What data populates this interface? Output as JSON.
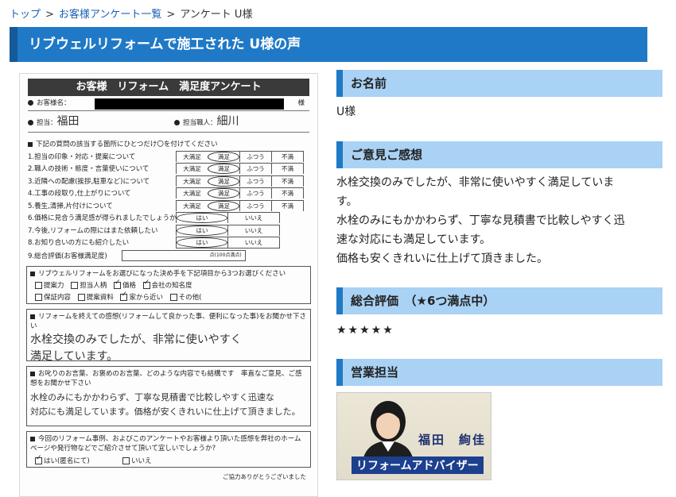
{
  "breadcrumb": {
    "home": "トップ",
    "list": "お客様アンケート一覧",
    "current": "アンケート U様",
    "separator": ">"
  },
  "page_title": "リブウェルリフォームで施工された U様の声",
  "survey": {
    "heading": "お客様　リフォーム　満足度アンケート",
    "customer_label": "お客様名：",
    "customer_suffix": "様",
    "rep_label": "担当：",
    "rep_value": "福田",
    "craftsman_label": "担当職人：",
    "craftsman_value": "細川",
    "instruction": "下記の質問の該当する箇所にひとつだけ〇を付けてください",
    "questions": [
      {
        "text": "1.担当の印象・対応・提案について",
        "opts": [
          "大満足",
          "満足",
          "ふつう",
          "不満"
        ]
      },
      {
        "text": "2.職人の技術・態度・言葉使いについて",
        "opts": [
          "大満足",
          "満足",
          "ふつう",
          "不満"
        ]
      },
      {
        "text": "3.近隣への配慮(挨拶,駐車など)について",
        "opts": [
          "大満足",
          "満足",
          "ふつう",
          "不満"
        ]
      },
      {
        "text": "4.工事の段取り,仕上がりについて",
        "opts": [
          "大満足",
          "満足",
          "ふつう",
          "不満"
        ]
      },
      {
        "text": "5.養生,清掃,片付けについて",
        "opts": [
          "大満足",
          "満足",
          "ふつう",
          "不満"
        ]
      },
      {
        "text": "6.価格に見合う満足感が得られましたでしょうか?",
        "opts": [
          "はい",
          "いいえ"
        ]
      },
      {
        "text": "7.今後,リフォームの際にはまた依頼したい",
        "opts": [
          "はい",
          "いいえ"
        ]
      },
      {
        "text": "8.お知り合いの方にも紹介したい",
        "opts": [
          "はい",
          "いいえ"
        ]
      }
    ],
    "overall_label": "9.総合評価(お客様満足度)",
    "overall_unit": "点(100点満点)",
    "reason_heading": "リブウェルリフォームをお選びになった決め手を下記項目から3つお選びください",
    "reasons": [
      {
        "label": "提案力",
        "checked": false
      },
      {
        "label": "担当人柄",
        "checked": false
      },
      {
        "label": "価格",
        "checked": true
      },
      {
        "label": "会社の知名度",
        "checked": true
      },
      {
        "label": "保証内容",
        "checked": false
      },
      {
        "label": "提案資料",
        "checked": false
      },
      {
        "label": "家から近い",
        "checked": true
      },
      {
        "label": "その他(",
        "checked": false
      }
    ],
    "impression_heading": "リフォームを終えての感想(リフォームして良かった事、便利になった事)をお聞かせ下さい",
    "impression_hand": [
      "水栓交換のみでしたが、非常に使いやすく",
      "満足しています。"
    ],
    "complaint_heading": "お叱りのお言葉、お褒めのお言葉、どのような内容でも結構です　率直なご意見、ご感想をお聞かせ下さい",
    "complaint_hand": [
      "水栓のみにもかかわらず、丁寧な見積書で比較しやすく迅速な",
      "対応にも満足しています。価格が安くきれいに仕上げて頂きました。"
    ],
    "publish_heading": "今回のリフォーム事例、およびこのアンケートやお客様より頂いた感想を弊社のホームページや発行物などでご紹介させて頂いて宜しいでしょうか?",
    "publish_yes": "はい(匿名にて)",
    "publish_no": "いいえ",
    "thanks": "ご協力ありがとうございました"
  },
  "sections": {
    "name": {
      "heading": "お名前",
      "value": "U様"
    },
    "opinion": {
      "heading": "ご意見ご感想",
      "lines": [
        "水栓交換のみでしたが、非常に使いやすく満足していま",
        "す。",
        "水栓のみにもかかわらず、丁寧な見積書で比較しやすく迅",
        "速な対応にも満足しています。",
        "価格も安くきれいに仕上げて頂きました。"
      ]
    },
    "rating": {
      "heading": "総合評価　（★6つ満点中）",
      "stars": "★★★★★",
      "value": 5,
      "max": 6
    },
    "staff": {
      "heading": "営業担当",
      "name": "福田　絢佳",
      "role": "リフォームアドバイザー"
    }
  },
  "colors": {
    "title_bg": "#1f79c6",
    "section_bg": "#a9d2f5",
    "link": "#1a5fb4"
  }
}
